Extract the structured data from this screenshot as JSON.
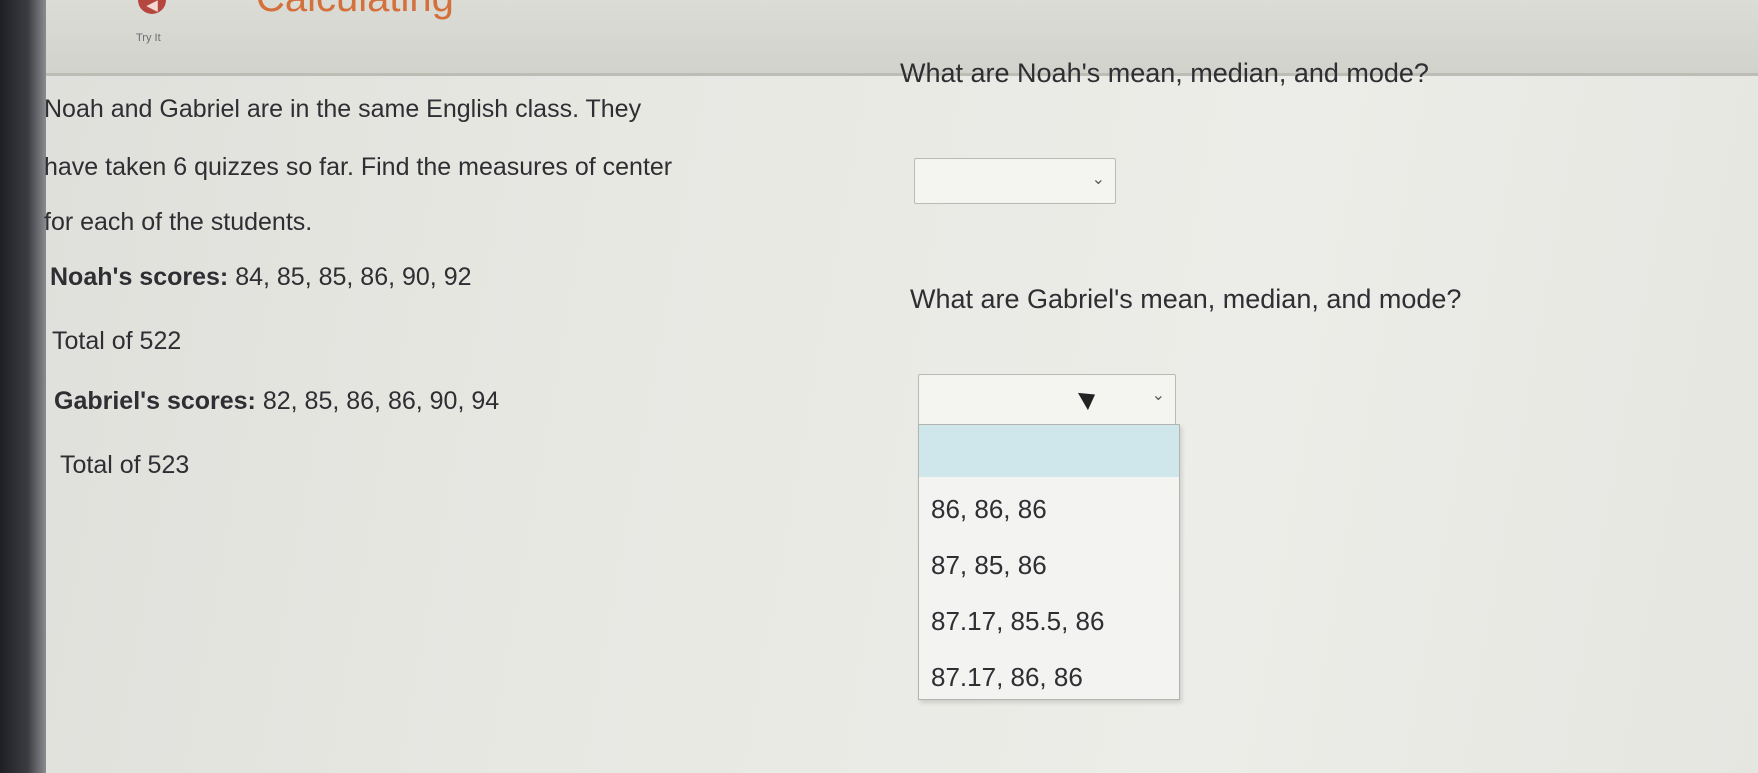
{
  "header": {
    "back_icon": "back-arrow-icon",
    "lesson_title": "Calculating",
    "try_it": "Try It"
  },
  "problem": {
    "intro_line1": "Noah and Gabriel are in the same English class. They",
    "intro_line2": "have taken 6 quizzes so far. Find the measures of center",
    "intro_line3": "for each of the students.",
    "noah_label": "Noah's scores:",
    "noah_scores": "84, 85, 85, 86, 90, 92",
    "noah_total": "Total of 522",
    "gabriel_label": "Gabriel's scores:",
    "gabriel_scores": "82, 85, 86, 86, 90, 94",
    "gabriel_total": "Total of 523"
  },
  "questions": {
    "noah_question": "What are Noah's mean, median, and mode?",
    "noah_selected": "",
    "gabriel_question": "What are Gabriel's mean, median, and mode?",
    "gabriel_selected": ""
  },
  "dropdown": {
    "options": [
      "",
      "86, 86, 86",
      "87, 85, 86",
      "87.17, 85.5, 86",
      "87.17, 86, 86"
    ],
    "highlighted_index": 0
  },
  "colors": {
    "highlight": "#cfe7ea",
    "title_orange": "#d4703c",
    "back_button": "#b5473f"
  }
}
